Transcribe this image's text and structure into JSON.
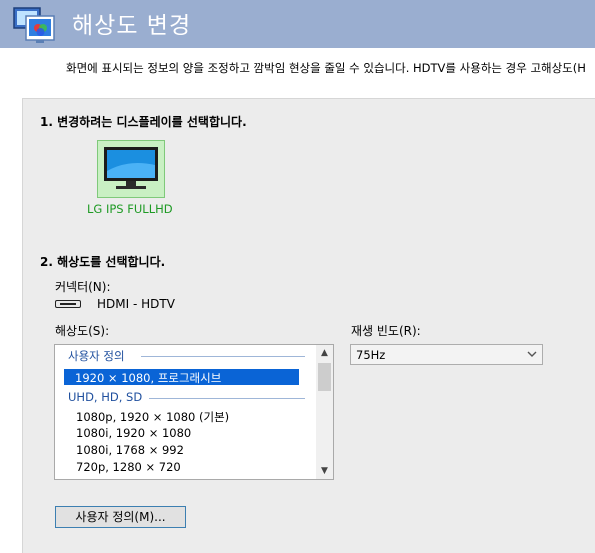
{
  "window": {
    "title": "해상도 변경",
    "description": "화면에 표시되는 정보의 양을 조정하고 깜박임 현상을 줄일 수 있습니다. HDTV를 사용하는 경우 고해상도(H"
  },
  "section1": {
    "heading": "1. 변경하려는 디스플레이를 선택합니다.",
    "display_label": "LG IPS FULLHD"
  },
  "section2": {
    "heading": "2. 해상도를 선택합니다.",
    "connector_label": "커넥터(N):",
    "connector_value": "HDMI - HDTV",
    "resolution_label": "해상도(S):",
    "refresh_label": "재생 빈도(R):",
    "refresh_value": "75Hz",
    "groups": [
      "사용자 정의",
      "UHD, HD, SD"
    ],
    "selected_item": "1920 × 1080, 프로그래시브",
    "items": [
      "1080p, 1920 × 1080 (기본)",
      "1080i, 1920 × 1080",
      "1080i, 1768 × 992",
      "720p, 1280 × 720"
    ],
    "custom_button": "사용자 정의(M)..."
  }
}
